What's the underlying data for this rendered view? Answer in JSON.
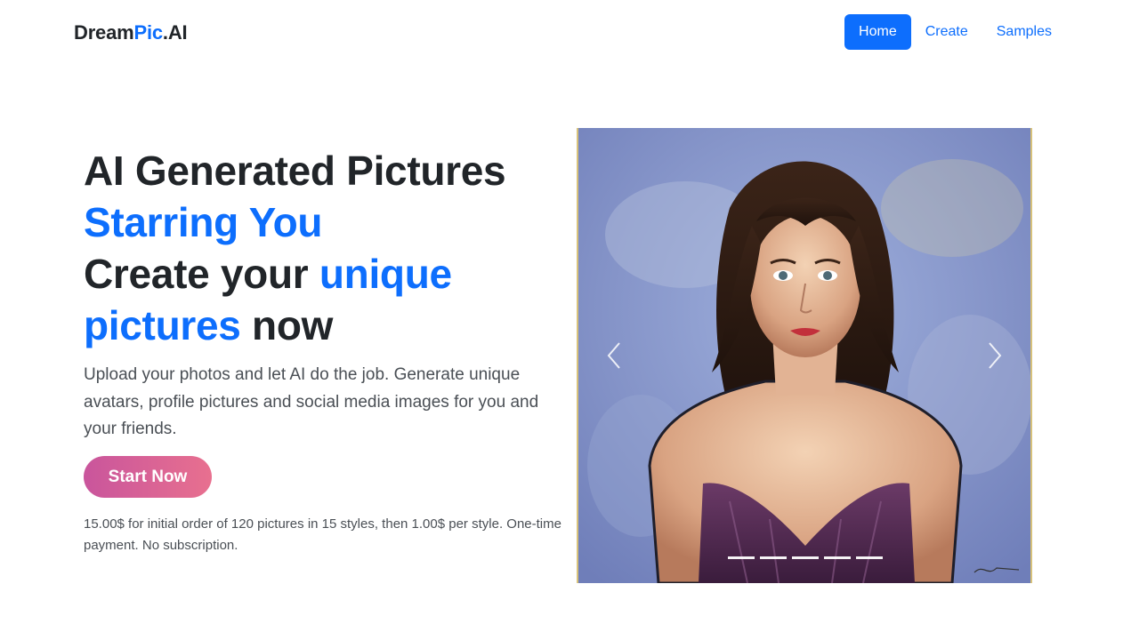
{
  "brand": {
    "part1": "Dream",
    "part2": "Pic",
    "part3": ".AI"
  },
  "nav": {
    "items": [
      {
        "label": "Home",
        "active": true
      },
      {
        "label": "Create",
        "active": false
      },
      {
        "label": "Samples",
        "active": false
      }
    ]
  },
  "hero": {
    "line1": "AI Generated Pictures",
    "line2": "Starring You",
    "line3a": "Create your ",
    "line3b": "unique",
    "line4a": "pictures",
    "line4b": " now",
    "description": "Upload your photos and let AI do the job. Generate unique avatars, profile pictures and social media images for you and your friends.",
    "cta_label": "Start Now",
    "price_note": "15.00$ for initial order of 120 pictures in 15 styles, then 1.00$ per style. One-time payment. No subscription."
  },
  "carousel": {
    "slide_count": 5,
    "active_index": 0,
    "prev_icon": "chevron-left-icon",
    "next_icon": "chevron-right-icon"
  },
  "colors": {
    "primary": "#0d6efd",
    "text": "#212529",
    "cta_gradient_start": "#c9559c",
    "cta_gradient_end": "#e8708f"
  }
}
